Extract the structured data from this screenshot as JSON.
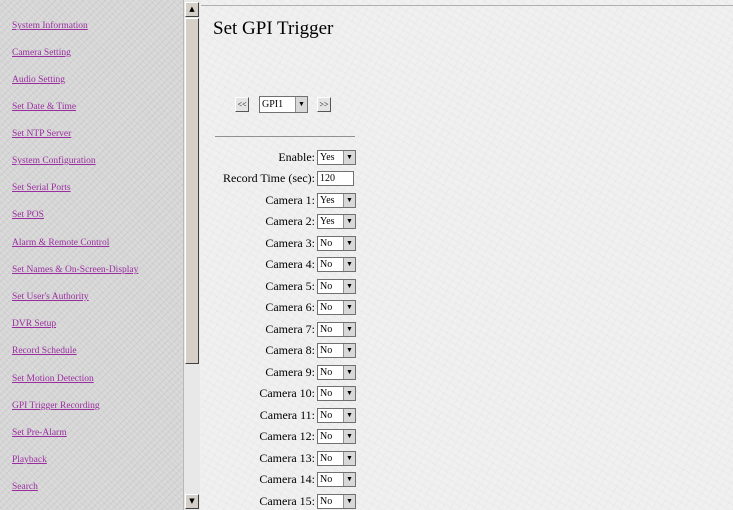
{
  "sidebar": {
    "items": [
      {
        "label": "System Information"
      },
      {
        "label": "Camera Setting"
      },
      {
        "label": "Audio Setting"
      },
      {
        "label": "Set Date & Time"
      },
      {
        "label": "Set NTP Server"
      },
      {
        "label": "System Configuration"
      },
      {
        "label": "Set Serial Ports"
      },
      {
        "label": "Set POS"
      },
      {
        "label": "Alarm & Remote Control"
      },
      {
        "label": "Set Names & On-Screen-Display"
      },
      {
        "label": "Set User's Authority"
      },
      {
        "label": "DVR Setup"
      },
      {
        "label": "Record Schedule"
      },
      {
        "label": "Set Motion Detection"
      },
      {
        "label": "GPI Trigger Recording"
      },
      {
        "label": "Set Pre-Alarm"
      },
      {
        "label": "Playback"
      },
      {
        "label": "Search"
      }
    ]
  },
  "main": {
    "title": "Set GPI Trigger",
    "prev_label": "<<",
    "next_label": ">>",
    "gpi_select": {
      "value": "GPI1"
    },
    "fields": [
      {
        "label": "Enable:",
        "type": "select",
        "value": "Yes"
      },
      {
        "label": "Record Time (sec):",
        "type": "input",
        "value": "120"
      },
      {
        "label": "Camera 1:",
        "type": "select",
        "value": "Yes"
      },
      {
        "label": "Camera 2:",
        "type": "select",
        "value": "Yes"
      },
      {
        "label": "Camera 3:",
        "type": "select",
        "value": "No"
      },
      {
        "label": "Camera 4:",
        "type": "select",
        "value": "No"
      },
      {
        "label": "Camera 5:",
        "type": "select",
        "value": "No"
      },
      {
        "label": "Camera 6:",
        "type": "select",
        "value": "No"
      },
      {
        "label": "Camera 7:",
        "type": "select",
        "value": "No"
      },
      {
        "label": "Camera 8:",
        "type": "select",
        "value": "No"
      },
      {
        "label": "Camera 9:",
        "type": "select",
        "value": "No"
      },
      {
        "label": "Camera 10:",
        "type": "select",
        "value": "No"
      },
      {
        "label": "Camera 11:",
        "type": "select",
        "value": "No"
      },
      {
        "label": "Camera 12:",
        "type": "select",
        "value": "No"
      },
      {
        "label": "Camera 13:",
        "type": "select",
        "value": "No"
      },
      {
        "label": "Camera 14:",
        "type": "select",
        "value": "No"
      },
      {
        "label": "Camera 15:",
        "type": "select",
        "value": "No"
      }
    ]
  },
  "icons": {
    "scroll_up": "scroll-up-arrow-icon",
    "scroll_down": "scroll-down-arrow-icon",
    "dropdown": "dropdown-arrow-icon"
  },
  "colors": {
    "link": "#9a2ea0",
    "sidebar_bg": "#d6d6d6",
    "main_bg": "#f0f0f0"
  }
}
